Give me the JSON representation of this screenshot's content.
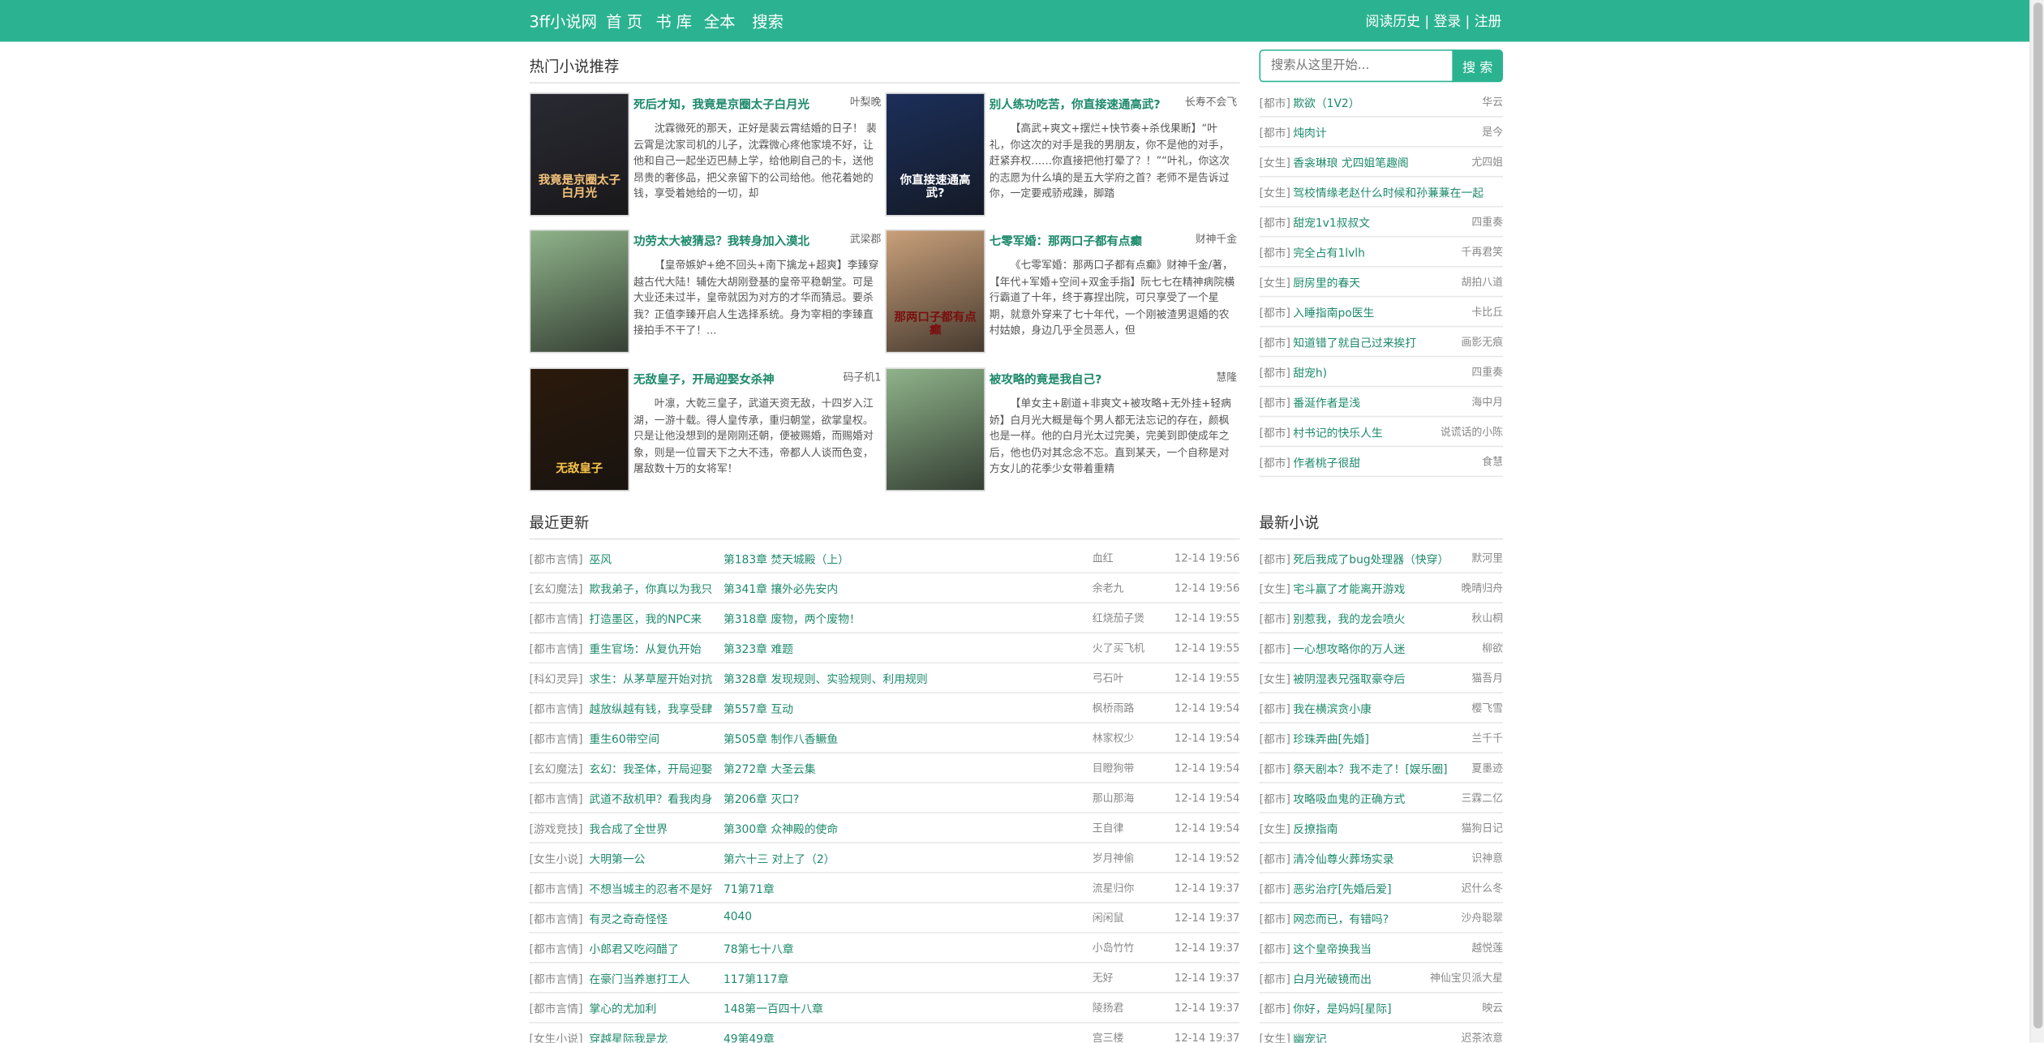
{
  "header": {
    "brand": "3ff小说网",
    "nav": [
      "首 页",
      "书 库",
      "全本",
      "搜索"
    ],
    "links": "阅读历史 | 登录 | 注册"
  },
  "hot": {
    "title": "热门小说推荐",
    "books": [
      {
        "title": "死后才知，我竟是京圈太子白月光",
        "author": "叶梨晚",
        "desc": "沈霖微死的那天，正好是裴云霄结婚的日子！ 裴云霄是沈家司机的儿子，沈霖微心疼他家境不好，让他和自己一起坐迈巴赫上学，给他刷自己的卡，送他昂贵的奢侈品，把父亲留下的公司给他。他花着她的钱，享受着她给的一切，却",
        "cover_text": "我竟是京圈太子白月光",
        "cover_bg": "#2a2a33",
        "cover_fg": "#f3c27a"
      },
      {
        "title": "别人练功吃苦，你直接速通高武?",
        "author": "长寿不会飞",
        "desc": "【高武+爽文+摆烂+快节奏+杀伐果断】“叶礼，你这次的对手是我的男朋友，你不是他的对手，赶紧弃权……你直接把他打晕了？！”“叶礼，你这次的志愿为什么填的是五大学府之首？老师不是告诉过你，一定要戒骄戒躁，脚踏",
        "cover_text": "你直接速通高武?",
        "cover_bg": "#1c2f5a",
        "cover_fg": "#ffffff"
      },
      {
        "title": "功劳太大被猜忌？我转身加入漠北",
        "author": "武梁郡",
        "desc": "【皇帝嫉妒+绝不回头+南下擒龙+超爽】李臻穿越古代大陆！辅佐大胡刚登基的皇帝平稳朝堂。可是大业还未过半，皇帝就因为对方的才华而猜忌。要杀我？正值李臻开启人生选择系统。身为宰相的李臻直接拍手不干了！...",
        "cover_text": "",
        "cover_bg": "#8fb38a",
        "cover_fg": "#ffffff"
      },
      {
        "title": "七零军婚：那两口子都有点癫",
        "author": "财神千金",
        "desc": "《七零军婚：那两口子都有点癫》财神千金/著，【年代+军婚+空间+双金手指】阮七七在精神病院横行霸道了十年，终于寡捏出院，可只享受了一个星期，就意外穿来了七十年代，一个刚被渣男退婚的农村姑娘，身边几乎全员恶人，但",
        "cover_text": "那两口子都有点癫",
        "cover_bg": "#c9a07a",
        "cover_fg": "#7a1010"
      },
      {
        "title": "无敌皇子，开局迎娶女杀神",
        "author": "码子机1",
        "desc": "叶凛，大乾三皇子，武道天资无敌，十四岁入江湖，一游十载。得人皇传承，重归朝堂，欲掌皇权。只是让他没想到的是刚刚还朝，便被赐婚，而赐婚对象，则是一位冒天下之大不违，帝都人人谈而色变，屠敌数十万的女将军！",
        "cover_text": "无敌皇子",
        "cover_bg": "#2b1a0c",
        "cover_fg": "#f7c44a"
      },
      {
        "title": "被攻略的竟是我自己?",
        "author": "慧隆",
        "desc": "【单女主+剧道+非爽文+被攻略+无外挂+轻病娇】白月光大概是每个男人都无法忘记的存在，颜枫也是一样。他的白月光太过完美，完美到即使成年之后，他也仍对其念念不忘。直到某天，一个自称是对方女儿的花季少女带着重精",
        "cover_text": "",
        "cover_bg": "#8fb38a",
        "cover_fg": "#ffffff"
      }
    ]
  },
  "search": {
    "placeholder": "搜索从这里开始...",
    "button": "搜 索"
  },
  "side_top": [
    {
      "cat": "[都市]",
      "name": "欺欲（1V2）",
      "author": "华云"
    },
    {
      "cat": "[都市]",
      "name": "炖肉计",
      "author": "是今"
    },
    {
      "cat": "[女生]",
      "name": "香衾琳琅 尤四姐笔趣阁",
      "author": "尤四姐"
    },
    {
      "cat": "[女生]",
      "name": "驾校情缘老赵什么时候和孙蒹蒹在一起",
      "author": ""
    },
    {
      "cat": "[都市]",
      "name": "甜宠1v1叔叔文",
      "author": "四重奏"
    },
    {
      "cat": "[都市]",
      "name": "完全占有1lvlh",
      "author": "千再君笑"
    },
    {
      "cat": "[女生]",
      "name": "厨房里的春天",
      "author": "胡拍八道"
    },
    {
      "cat": "[都市]",
      "name": "入睡指南po医生",
      "author": "卡比丘"
    },
    {
      "cat": "[都市]",
      "name": "知道错了就自己过来挨打",
      "author": "画影无痕"
    },
    {
      "cat": "[都市]",
      "name": "甜宠h)",
      "author": "四重奏"
    },
    {
      "cat": "[都市]",
      "name": "番涎作者是浅",
      "author": "海中月"
    },
    {
      "cat": "[都市]",
      "name": "村书记的快乐人生",
      "author": "说谎话的小陈"
    },
    {
      "cat": "[都市]",
      "name": "作者桃子很甜",
      "author": "食慧"
    }
  ],
  "latest": {
    "title": "最近更新",
    "rows": [
      {
        "cat": "[都市言情]",
        "name": "巫风",
        "chapter": "第183章 焚天城殿（上）",
        "author": "血红",
        "time": "12-14 19:56"
      },
      {
        "cat": "[玄幻魔法]",
        "name": "欺我弟子，你真以为我只",
        "chapter": "第341章 攘外必先安内",
        "author": "余老九",
        "time": "12-14 19:56"
      },
      {
        "cat": "[都市言情]",
        "name": "打造墨区，我的NPC来",
        "chapter": "第318章 废物，两个废物！",
        "author": "红烧茄子煲",
        "time": "12-14 19:55"
      },
      {
        "cat": "[都市言情]",
        "name": "重生官场：从复仇开始",
        "chapter": "第323章 难题",
        "author": "火了买飞机",
        "time": "12-14 19:55"
      },
      {
        "cat": "[科幻灵异]",
        "name": "求生：从茅草屋开始对抗",
        "chapter": "第328章 发现规则、实验规则、利用规则",
        "author": "弓石叶",
        "time": "12-14 19:55"
      },
      {
        "cat": "[都市言情]",
        "name": "越放纵越有钱，我享受肆",
        "chapter": "第557章 互动",
        "author": "枫桥雨路",
        "time": "12-14 19:54"
      },
      {
        "cat": "[都市言情]",
        "name": "重生60带空间",
        "chapter": "第505章 制作八香鳜鱼",
        "author": "林家权少",
        "time": "12-14 19:54"
      },
      {
        "cat": "[玄幻魔法]",
        "name": "玄幻：我圣体，开局迎娶",
        "chapter": "第272章 大圣云集",
        "author": "目瞪狗带",
        "time": "12-14 19:54"
      },
      {
        "cat": "[都市言情]",
        "name": "武道不敌机甲？看我肉身",
        "chapter": "第206章 灭口?",
        "author": "那山那海",
        "time": "12-14 19:54"
      },
      {
        "cat": "[游戏竞技]",
        "name": "我合成了全世界",
        "chapter": "第300章 众神殿的使命",
        "author": "王自律",
        "time": "12-14 19:54"
      },
      {
        "cat": "[女生小说]",
        "name": "大明第一公",
        "chapter": "第六十三 对上了（2）",
        "author": "岁月神偷",
        "time": "12-14 19:52"
      },
      {
        "cat": "[都市言情]",
        "name": "不想当城主的忍者不是好",
        "chapter": "71第71章",
        "author": "流星归你",
        "time": "12-14 19:37"
      },
      {
        "cat": "[都市言情]",
        "name": "有灵之奇奇怪怪",
        "chapter": "4040",
        "author": "闲闲鼠",
        "time": "12-14 19:37"
      },
      {
        "cat": "[都市言情]",
        "name": "小郎君又吃闷醋了",
        "chapter": "78第七十八章",
        "author": "小岛竹竹",
        "time": "12-14 19:37"
      },
      {
        "cat": "[都市言情]",
        "name": "在豪门当养崽打工人",
        "chapter": "117第117章",
        "author": "无好",
        "time": "12-14 19:37"
      },
      {
        "cat": "[都市言情]",
        "name": "掌心的尤加利",
        "chapter": "148第一百四十八章",
        "author": "陵扬君",
        "time": "12-14 19:37"
      },
      {
        "cat": "[女生小说]",
        "name": "穿越星际我是龙",
        "chapter": "49第49章",
        "author": "宫三楼",
        "time": "12-14 19:37"
      }
    ]
  },
  "newest": {
    "title": "最新小说",
    "rows": [
      {
        "cat": "[都市]",
        "name": "死后我成了bug处理器（快穿）",
        "author": "默河里"
      },
      {
        "cat": "[女生]",
        "name": "宅斗赢了才能离开游戏",
        "author": "晚晴归舟"
      },
      {
        "cat": "[都市]",
        "name": "别惹我，我的龙会喷火",
        "author": "秋山桐"
      },
      {
        "cat": "[都市]",
        "name": "一心想攻略你的万人迷",
        "author": "柳欲"
      },
      {
        "cat": "[女生]",
        "name": "被阴湿表兄强取豪夺后",
        "author": "猫吾月"
      },
      {
        "cat": "[都市]",
        "name": "我在横滨贪小康",
        "author": "樱飞雪"
      },
      {
        "cat": "[都市]",
        "name": "珍珠弄曲[先婚]",
        "author": "兰千千"
      },
      {
        "cat": "[都市]",
        "name": "祭天剧本？我不走了！[娱乐圈]",
        "author": "夏墨迹"
      },
      {
        "cat": "[都市]",
        "name": "攻略吸血鬼的正确方式",
        "author": "三霖二亿"
      },
      {
        "cat": "[女生]",
        "name": "反撩指南",
        "author": "猫狗日记"
      },
      {
        "cat": "[都市]",
        "name": "清冷仙尊火葬场实录",
        "author": "识神意"
      },
      {
        "cat": "[都市]",
        "name": "恶劣治疗[先婚后爱]",
        "author": "迟什么冬"
      },
      {
        "cat": "[都市]",
        "name": "网恋而已，有错吗?",
        "author": "沙舟聪翠"
      },
      {
        "cat": "[都市]",
        "name": "这个皇帝换我当",
        "author": "越悦莲"
      },
      {
        "cat": "[都市]",
        "name": "白月光破镜而出",
        "author": "神仙宝贝派大星"
      },
      {
        "cat": "[都市]",
        "name": "你好，是妈妈[星际]",
        "author": "映云"
      },
      {
        "cat": "[女生]",
        "name": "幽宠记",
        "author": "迟茶浓意"
      }
    ]
  }
}
